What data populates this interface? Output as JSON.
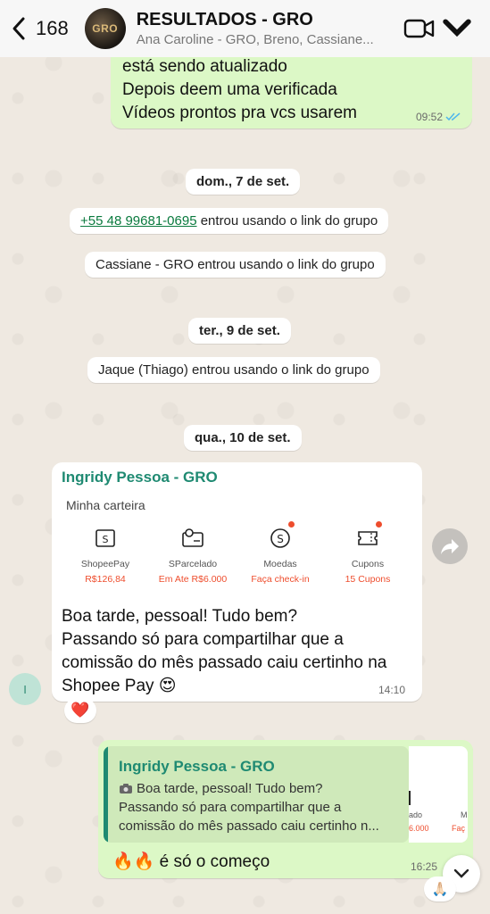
{
  "header": {
    "back_count": "168",
    "avatar_text": "GRO",
    "title": "RESULTADOS - GRO",
    "subtitle": "Ana Caroline - GRO, Breno, Cassiane..."
  },
  "top_message": {
    "lines": [
      "está sendo atualizado",
      "Depois deem uma verificada",
      "Vídeos prontos pra vcs usarem"
    ],
    "time": "09:52"
  },
  "system": {
    "date1": "dom., 7 de set.",
    "join1_phone": "+55 48 99681-0695",
    "join1_rest": " entrou usando o link do grupo",
    "join2": "Cassiane - GRO entrou usando o link do grupo",
    "date2": "ter., 9 de set.",
    "join3": "Jaque (Thiago) entrou usando o link do grupo",
    "date3": "qua., 10 de set."
  },
  "incoming": {
    "sender": "Ingridy Pessoa - GRO",
    "wallet": {
      "title": "Minha carteira",
      "items": [
        {
          "label": "ShopeePay",
          "value": "R$126,84",
          "icon": "wallet-icon"
        },
        {
          "label": "SParcelado",
          "value": "Em Ate R$6.000",
          "icon": "installment-icon"
        },
        {
          "label": "Moedas",
          "value": "Faça check-in",
          "icon": "coin-icon"
        },
        {
          "label": "Cupons",
          "value": "15 Cupons",
          "icon": "coupon-icon"
        }
      ]
    },
    "lines": [
      "Boa tarde, pessoal! Tudo bem?",
      "Passando só para compartilhar que a",
      "comissão do mês passado caiu certinho na",
      "Shopee Pay 😍"
    ],
    "time": "14:10",
    "reaction": "❤️",
    "avatar_initial": "I"
  },
  "outgoing": {
    "quote_sender": "Ingridy Pessoa - GRO",
    "quote_lines": [
      "Boa tarde, pessoal! Tudo bem?",
      "Passando só para compartilhar que a",
      "comissão do mês passado caiu certinho n..."
    ],
    "quote_thumb_lines": [
      "ado",
      "M",
      "6.000",
      "Faç"
    ],
    "text": "🔥🔥 é só o começo",
    "time": "16:25",
    "reaction": "🙏🏻"
  }
}
